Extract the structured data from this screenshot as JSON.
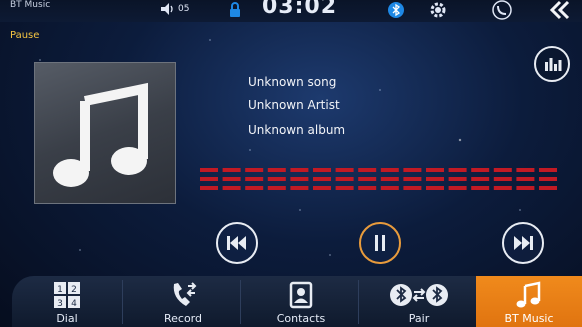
{
  "status_bar": {
    "app_title": "BT Music",
    "volume_label": "05",
    "clock": "03:02"
  },
  "player": {
    "state": "Pause",
    "song": "Unknown song",
    "artist": "Unknown Artist",
    "album": "Unknown album"
  },
  "dock": {
    "items": [
      {
        "label": "Dial"
      },
      {
        "label": "Record"
      },
      {
        "label": "Contacts"
      },
      {
        "label": "Pair"
      },
      {
        "label": "BT Music"
      }
    ],
    "active_index": 4
  },
  "icons": {
    "status": [
      "volume-icon",
      "lock-icon",
      "bluetooth-icon",
      "gear-icon",
      "phone-icon",
      "back-icon"
    ],
    "controls": [
      "equalizer-icon",
      "previous-track-icon",
      "pause-icon",
      "next-track-icon"
    ],
    "dock": [
      "dial-icon",
      "record-icon",
      "contacts-icon",
      "pair-icon",
      "bt-music-icon"
    ]
  },
  "colors": {
    "accent_orange": "#e07410",
    "pause_text": "#f5c542",
    "equalizer_red": "#c21a24",
    "background": "#0c1c3c"
  }
}
